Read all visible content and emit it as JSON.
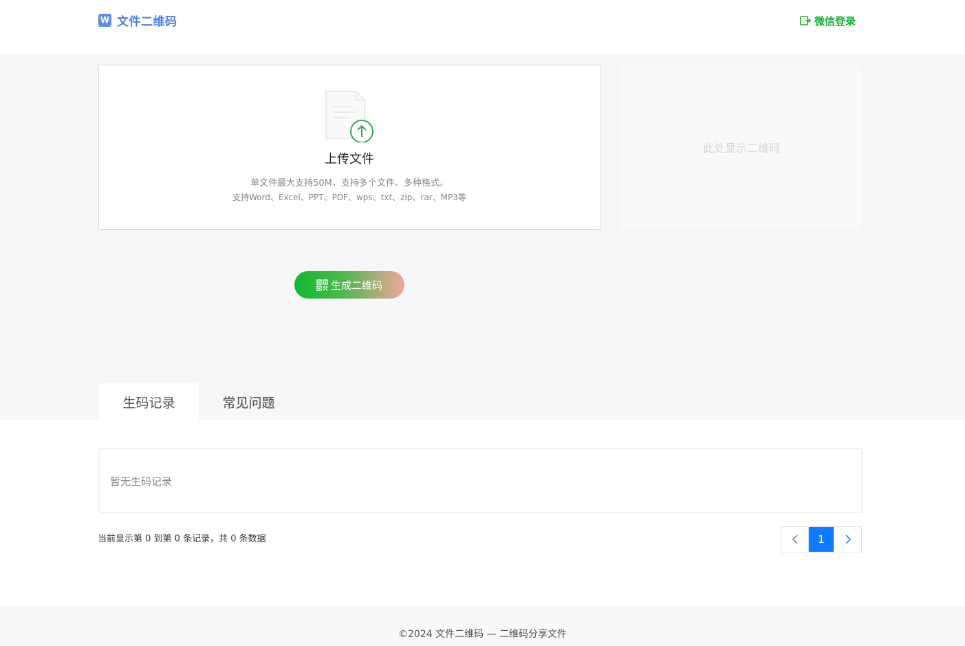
{
  "header": {
    "logo_icon": "W",
    "logo_text": "文件二维码",
    "login_label": "微信登录",
    "brand_color": "#4f7fe6",
    "login_color": "#1aad36"
  },
  "upload": {
    "title": "上传文件",
    "desc1": "单文件最大支持50M，支持多个文件、多种格式。",
    "desc2": "支持Word、Excel、PPT、PDF、wps、txt、zip、rar、MP3等"
  },
  "qr": {
    "placeholder": "此处显示二维码"
  },
  "generate_button": {
    "label": "生成二维码",
    "icon": "qrcode-icon"
  },
  "tabs": [
    {
      "label": "生码记录",
      "active": true
    },
    {
      "label": "常见问题",
      "active": false
    }
  ],
  "records": {
    "empty_text": "暂无生码记录",
    "info": "当前显示第 0 到第 0 条记录，共 0 条数据"
  },
  "pagination": {
    "current_page": "1",
    "prev_icon": "chevron-left-icon",
    "next_icon": "chevron-right-icon",
    "accent": "#0d7aff"
  },
  "footer": {
    "text": "©2024 文件二维码 — 二维码分享文件"
  }
}
